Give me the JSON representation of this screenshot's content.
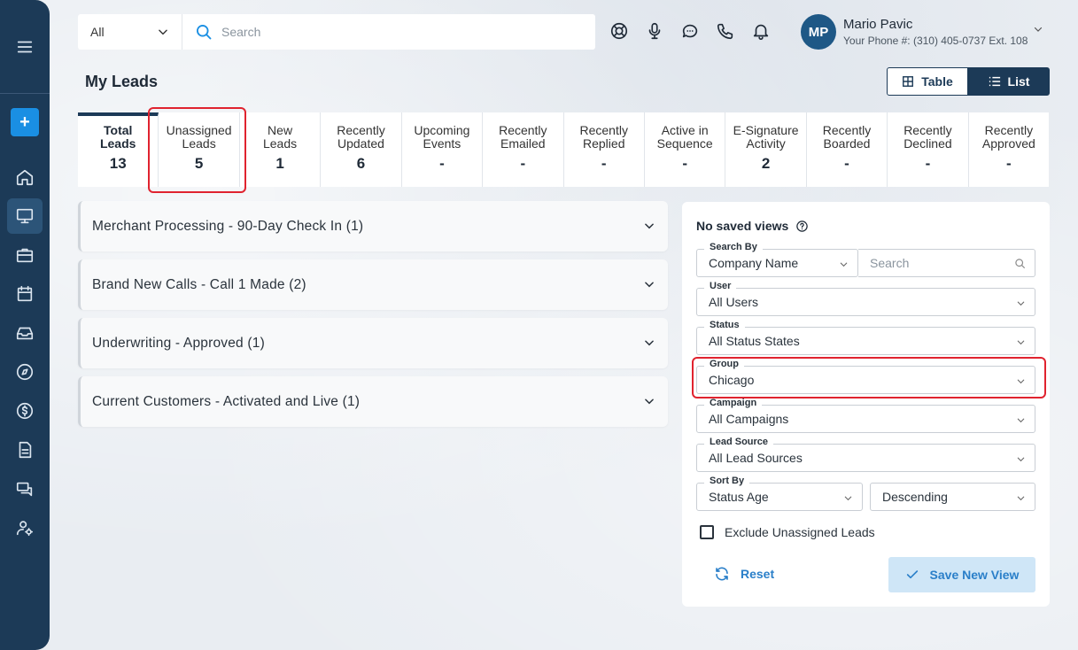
{
  "topbar": {
    "scope_value": "All",
    "search_placeholder": "Search"
  },
  "user": {
    "initials": "MP",
    "name": "Mario Pavic",
    "phone": "Your Phone #: (310) 405-0737 Ext. 108"
  },
  "page": {
    "title": "My Leads"
  },
  "view_toggle": {
    "table_label": "Table",
    "list_label": "List"
  },
  "stats": [
    {
      "label": "Total\nLeads",
      "value": "13"
    },
    {
      "label": "Unassigned\nLeads",
      "value": "5"
    },
    {
      "label": "New\nLeads",
      "value": "1"
    },
    {
      "label": "Recently\nUpdated",
      "value": "6"
    },
    {
      "label": "Upcoming\nEvents",
      "value": "-"
    },
    {
      "label": "Recently\nEmailed",
      "value": "-"
    },
    {
      "label": "Recently\nReplied",
      "value": "-"
    },
    {
      "label": "Active in\nSequence",
      "value": "-"
    },
    {
      "label": "E-Signature\nActivity",
      "value": "2"
    },
    {
      "label": "Recently\nBoarded",
      "value": "-"
    },
    {
      "label": "Recently\nDeclined",
      "value": "-"
    },
    {
      "label": "Recently\nApproved",
      "value": "-"
    }
  ],
  "groups": [
    {
      "label": "Merchant Processing - 90-Day Check In (1)"
    },
    {
      "label": "Brand New Calls - Call 1 Made (2)"
    },
    {
      "label": "Underwriting - Approved (1)"
    },
    {
      "label": "Current Customers - Activated and Live (1)"
    }
  ],
  "filters": {
    "no_saved_views": "No saved views",
    "search_by_label": "Search By",
    "search_by_value": "Company Name",
    "search_placeholder": "Search",
    "user_label": "User",
    "user_value": "All Users",
    "status_label": "Status",
    "status_value": "All Status States",
    "group_label": "Group",
    "group_value": "Chicago",
    "campaign_label": "Campaign",
    "campaign_value": "All Campaigns",
    "lead_source_label": "Lead Source",
    "lead_source_value": "All Lead Sources",
    "sort_by_label": "Sort By",
    "sort_by_value": "Status Age",
    "sort_order_value": "Descending",
    "exclude_label": "Exclude Unassigned Leads",
    "reset_label": "Reset",
    "save_label": "Save New View"
  },
  "colors": {
    "sidebar": "#1c3a57",
    "accent": "#2a7fc9",
    "highlight": "#e0232f"
  }
}
